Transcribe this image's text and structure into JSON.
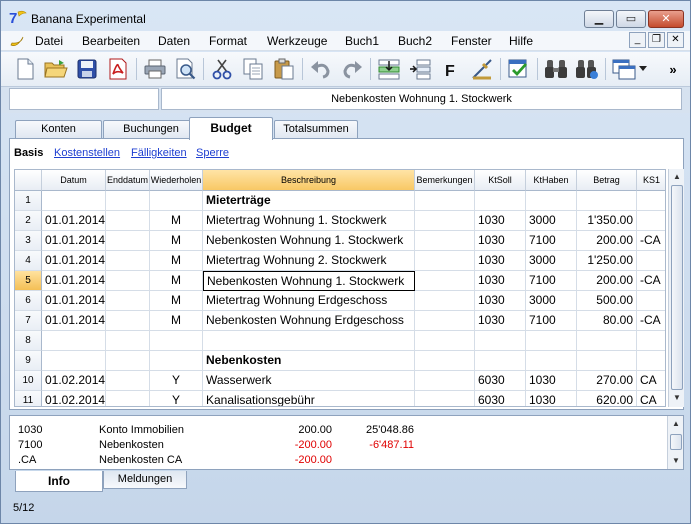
{
  "window": {
    "title": "Banana Experimental"
  },
  "menu": [
    "Datei",
    "Bearbeiten",
    "Daten",
    "Format",
    "Werkzeuge",
    "Buch1",
    "Buch2",
    "Fenster",
    "Hilfe"
  ],
  "toolbar": {
    "overflow": "»"
  },
  "formula_bar": {
    "cell_ref": "",
    "content": "Nebenkosten Wohnung 1. Stockwerk"
  },
  "tabs": [
    "Konten",
    "Buchungen",
    "Budget",
    "Totalsummen"
  ],
  "active_tab": "Budget",
  "views": [
    "Basis",
    "Kostenstellen",
    "Fälligkeiten",
    "Sperre"
  ],
  "table": {
    "columns": [
      "Datum",
      "Enddatum",
      "Wiederholen",
      "Beschreibung",
      "Bemerkungen",
      "KtSoll",
      "KtHaben",
      "Betrag",
      "KS1"
    ],
    "rows": [
      {
        "n": "1",
        "datum": "",
        "end": "",
        "wdh": "",
        "beschr": "Mieterträge",
        "bem": "",
        "soll": "",
        "haben": "",
        "betrag": "",
        "ks1": "",
        "bold": true
      },
      {
        "n": "2",
        "datum": "01.01.2014",
        "end": "",
        "wdh": "M",
        "beschr": "Mietertrag Wohnung 1. Stockwerk",
        "bem": "",
        "soll": "1030",
        "haben": "3000",
        "betrag": "1'350.00",
        "ks1": ""
      },
      {
        "n": "3",
        "datum": "01.01.2014",
        "end": "",
        "wdh": "M",
        "beschr": "Nebenkosten Wohnung 1. Stockwerk",
        "bem": "",
        "soll": "1030",
        "haben": "7100",
        "betrag": "200.00",
        "ks1": "-CA"
      },
      {
        "n": "4",
        "datum": "01.01.2014",
        "end": "",
        "wdh": "M",
        "beschr": "Mietertrag Wohnung 2. Stockwerk",
        "bem": "",
        "soll": "1030",
        "haben": "3000",
        "betrag": "1'250.00",
        "ks1": ""
      },
      {
        "n": "5",
        "datum": "01.01.2014",
        "end": "",
        "wdh": "M",
        "beschr": "Nebenkosten Wohnung 1. Stockwerk",
        "bem": "",
        "soll": "1030",
        "haben": "7100",
        "betrag": "200.00",
        "ks1": "-CA",
        "selected": true
      },
      {
        "n": "6",
        "datum": "01.01.2014",
        "end": "",
        "wdh": "M",
        "beschr": "Mietertrag Wohnung Erdgeschoss",
        "bem": "",
        "soll": "1030",
        "haben": "3000",
        "betrag": "500.00",
        "ks1": ""
      },
      {
        "n": "7",
        "datum": "01.01.2014",
        "end": "",
        "wdh": "M",
        "beschr": "Nebenkosten Wohnung Erdgeschoss",
        "bem": "",
        "soll": "1030",
        "haben": "7100",
        "betrag": "80.00",
        "ks1": "-CA"
      },
      {
        "n": "8",
        "datum": "",
        "end": "",
        "wdh": "",
        "beschr": "",
        "bem": "",
        "soll": "",
        "haben": "",
        "betrag": "",
        "ks1": ""
      },
      {
        "n": "9",
        "datum": "",
        "end": "",
        "wdh": "",
        "beschr": "Nebenkosten",
        "bem": "",
        "soll": "",
        "haben": "",
        "betrag": "",
        "ks1": "",
        "bold": true
      },
      {
        "n": "10",
        "datum": "01.02.2014",
        "end": "",
        "wdh": "Y",
        "beschr": "Wasserwerk",
        "bem": "",
        "soll": "6030",
        "haben": "1030",
        "betrag": "270.00",
        "ks1": "CA"
      },
      {
        "n": "11",
        "datum": "01.02.2014",
        "end": "",
        "wdh": "Y",
        "beschr": "Kanalisationsgebühr",
        "bem": "",
        "soll": "6030",
        "haben": "1030",
        "betrag": "620.00",
        "ks1": "CA"
      }
    ]
  },
  "info": [
    {
      "code": "1030",
      "name": "Konto Immobilien",
      "amount": "200.00",
      "balance": "25'048.86",
      "amount_neg": false,
      "balance_neg": false
    },
    {
      "code": "7100",
      "name": "Nebenkosten",
      "amount": "-200.00",
      "balance": "-6'487.11",
      "amount_neg": true,
      "balance_neg": true
    },
    {
      "code": ".CA",
      "name": "Nebenkosten CA",
      "amount": "-200.00",
      "balance": "",
      "amount_neg": true,
      "balance_neg": false
    }
  ],
  "bottom_tabs": [
    "Info",
    "Meldungen"
  ],
  "status": "5/12",
  "colors": {
    "negative": "#e00000",
    "link": "#1f3fd1",
    "selection": "#f8c865"
  }
}
